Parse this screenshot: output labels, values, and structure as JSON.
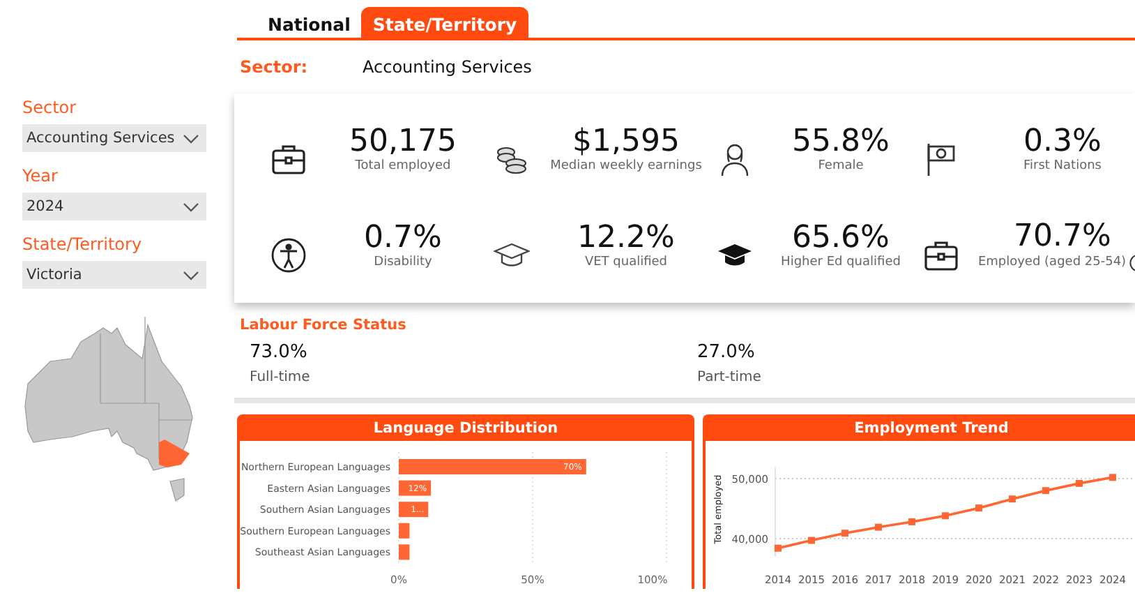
{
  "tabs": [
    {
      "label": "National",
      "selected": false
    },
    {
      "label": "State/Territory",
      "selected": true
    }
  ],
  "sector_heading": {
    "label": "Sector:",
    "value": "Accounting Services"
  },
  "filters": [
    {
      "label": "Sector",
      "value": "Accounting Services"
    },
    {
      "label": "Year",
      "value": "2024"
    },
    {
      "label": "State/Territory",
      "value": "Victoria"
    }
  ],
  "kpis": [
    {
      "kind": "briefcase",
      "value": "50,175",
      "label": "Total employed"
    },
    {
      "kind": "coins",
      "value": "$1,595",
      "label": "Median weekly earnings"
    },
    {
      "kind": "woman",
      "value": "55.8%",
      "label": "Female"
    },
    {
      "kind": "flag",
      "value": "0.3%",
      "label": "First Nations"
    },
    {
      "kind": "accessibility",
      "value": "0.7%",
      "label": "Disability"
    },
    {
      "kind": "cap-outline",
      "value": "12.2%",
      "label": "VET qualified"
    },
    {
      "kind": "cap-filled",
      "value": "65.6%",
      "label": "Higher Ed qualified"
    },
    {
      "kind": "briefcase",
      "value": "70.7%",
      "label": "Employed (aged 25-54)",
      "info": true
    }
  ],
  "labour_force": {
    "title": "Labour Force Status",
    "items": [
      {
        "value": "73.0%",
        "label": "Full-time"
      },
      {
        "value": "27.0%",
        "label": "Part-time"
      }
    ]
  },
  "language_chart": {
    "chart_data": {
      "type": "bar",
      "title": "Language Distribution",
      "orientation": "horizontal",
      "categories": [
        "Northern European Languages",
        "Eastern Asian Languages",
        "Southern Asian Languages",
        "Southern European Languages",
        "Southeast Asian Languages"
      ],
      "series": [
        {
          "color": "#ff6633",
          "values": [
            70,
            12,
            11,
            4,
            4
          ]
        }
      ],
      "value_labels": [
        "70%",
        "12%",
        "1...",
        null,
        null
      ],
      "xlim": [
        0,
        100
      ],
      "xticks": [
        {
          "value": 0,
          "label": "0%"
        },
        {
          "value": 50,
          "label": "50%"
        },
        {
          "value": 100,
          "label": "100%"
        }
      ]
    }
  },
  "trend_chart": {
    "chart_data": {
      "type": "line",
      "title": "Employment Trend",
      "ylabel": "Total employed",
      "x": [
        "2014",
        "2015",
        "2016",
        "2017",
        "2018",
        "2019",
        "2020",
        "2021",
        "2022",
        "2023",
        "2024"
      ],
      "series": [
        {
          "color": "#ff6633",
          "marker": "square",
          "values": [
            38400,
            39700,
            40900,
            41900,
            42800,
            43800,
            45100,
            46600,
            48000,
            49200,
            50200
          ]
        }
      ],
      "ylim": [
        37000,
        52000
      ],
      "yticks": [
        {
          "value": 40000,
          "label": "40,000"
        },
        {
          "value": 50000,
          "label": "50,000"
        }
      ]
    }
  }
}
